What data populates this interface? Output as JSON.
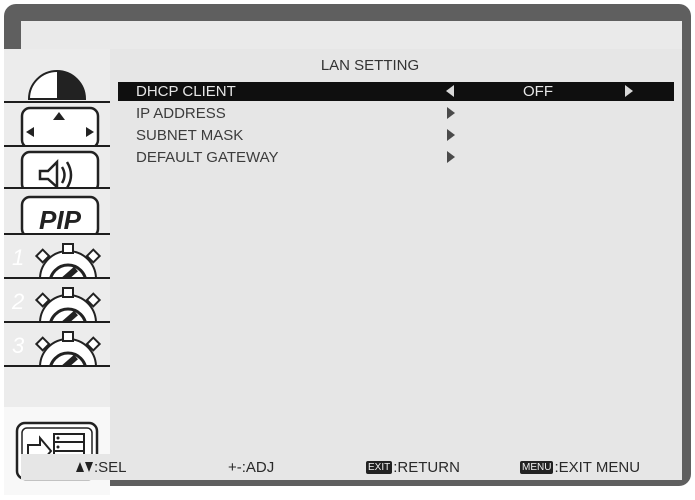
{
  "menu": {
    "title": "LAN SETTING",
    "rows": [
      {
        "label": "DHCP CLIENT",
        "value": "OFF"
      },
      {
        "label": "IP ADDRESS"
      },
      {
        "label": "SUBNET MASK"
      },
      {
        "label": "DEFAULT GATEWAY"
      }
    ]
  },
  "sidebar": {
    "items": [
      {
        "icon": "picture-icon"
      },
      {
        "icon": "screen-position-icon"
      },
      {
        "icon": "audio-icon"
      },
      {
        "icon": "pip-icon",
        "label": "PIP"
      },
      {
        "icon": "configuration-1-icon",
        "label": "1"
      },
      {
        "icon": "configuration-2-icon",
        "label": "2"
      },
      {
        "icon": "configuration-3-icon",
        "label": "3"
      },
      {
        "icon": "advanced-option-icon",
        "selected": true
      }
    ]
  },
  "footer": {
    "sel": ":SEL",
    "adj": "+-:ADJ",
    "exit_key": "EXIT",
    "return": ":RETURN",
    "menu_key": "MENU",
    "exit_menu": ":EXIT MENU"
  }
}
